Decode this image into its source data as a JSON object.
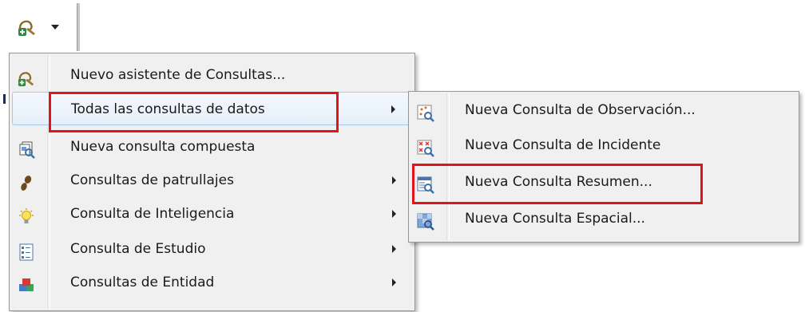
{
  "toolbar": {
    "query_button_icon": "query-wizard-icon",
    "dropdown_icon": "dropdown-arrow-icon"
  },
  "main_menu": {
    "items": [
      {
        "label": "Nuevo asistente de Consultas...",
        "icon": "query-wizard-icon",
        "submenu": false
      },
      {
        "label": "Todas las consultas de datos",
        "icon": "",
        "submenu": true,
        "active": true
      },
      {
        "label": "Nueva consulta compuesta",
        "icon": "compound-query-icon",
        "submenu": false
      },
      {
        "label": "Consultas de patrullajes",
        "icon": "footprints-icon",
        "submenu": true
      },
      {
        "label": "Consulta de Inteligencia",
        "icon": "lightbulb-icon",
        "submenu": true
      },
      {
        "label": "Consulta de Estudio",
        "icon": "list-form-icon",
        "submenu": true
      },
      {
        "label": "Consultas de Entidad",
        "icon": "entity-cubes-icon",
        "submenu": true
      }
    ]
  },
  "sub_menu": {
    "items": [
      {
        "label": "Nueva Consulta de Observación...",
        "icon": "observation-query-icon"
      },
      {
        "label": "Nueva Consulta de Incidente",
        "icon": "incident-query-icon"
      },
      {
        "label": "Nueva Consulta Resumen...",
        "icon": "summary-query-icon",
        "highlighted": true
      },
      {
        "label": "Nueva Consulta Espacial...",
        "icon": "spatial-query-icon"
      }
    ]
  },
  "colors": {
    "highlight_border": "#e0141b",
    "menu_background": "#f0f0f0",
    "active_item_border": "#a8c7e8"
  }
}
